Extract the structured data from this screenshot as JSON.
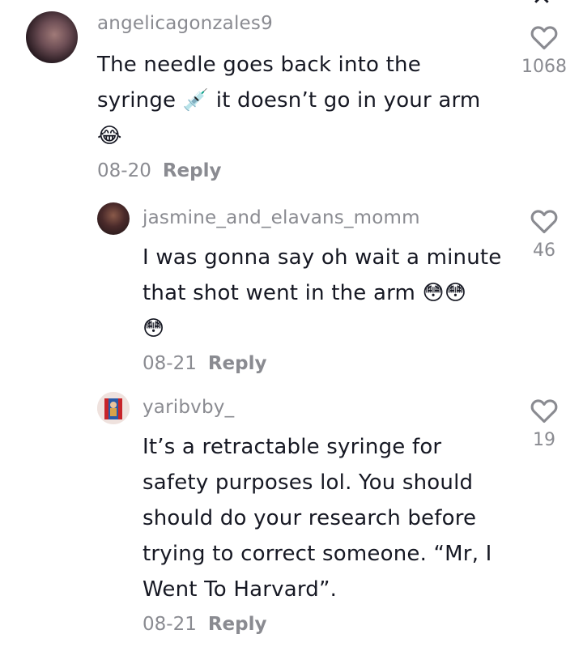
{
  "comments": [
    {
      "username": "angelicagonzales9",
      "text": "The needle goes back into the syringe 💉 it doesn’t go in your arm 😂",
      "lines": [
        "The needle goes back into the",
        "syringe 💉 it doesn’t go in your arm",
        "😂"
      ],
      "date": "08-20",
      "reply_label": "Reply",
      "likes": "1068"
    },
    {
      "username": "jasmine_and_elavans_momm",
      "text": "I was gonna say oh wait a minute that shot went in the arm 😳😳😳",
      "lines": [
        "I was gonna say oh wait a minute",
        "that shot went in the arm 😳😳",
        "😳"
      ],
      "date": "08-21",
      "reply_label": "Reply",
      "likes": "46"
    },
    {
      "username": "yaribvby_",
      "text": "It’s a retractable syringe for safety purposes lol. You should should do your research before trying to correct someone. “Mr, I Went To Harvard”.",
      "lines": [
        "It’s a retractable syringe for",
        "safety purposes lol. You should",
        "should do your research before",
        "trying to correct someone. “Mr, I",
        "Went To Harvard”."
      ],
      "date": "08-21",
      "reply_label": "Reply",
      "likes": "19"
    }
  ],
  "close_icon": "close-icon",
  "colors": {
    "text": "#161823",
    "muted": "#8a8b91",
    "background": "#ffffff"
  }
}
